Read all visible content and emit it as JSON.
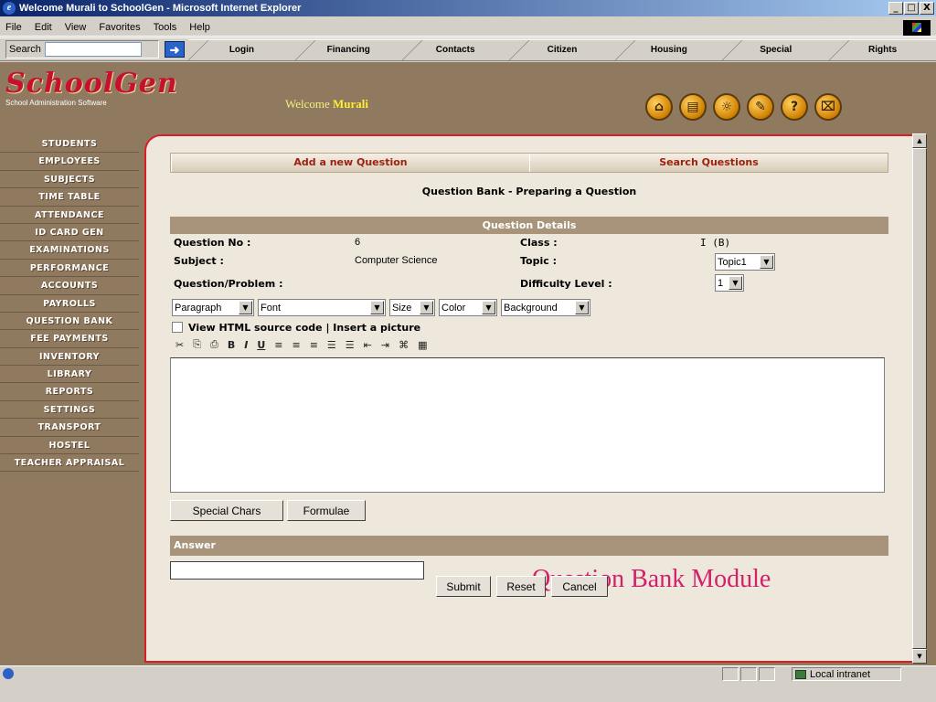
{
  "window": {
    "title": "Welcome Murali to SchoolGen - Microsoft Internet Explorer",
    "min": "_",
    "max": "□",
    "close": "X"
  },
  "menu": [
    "File",
    "Edit",
    "View",
    "Favorites",
    "Tools",
    "Help"
  ],
  "toolbar": {
    "search_label": "Search",
    "tabs": [
      "Login",
      "Financing",
      "Contacts",
      "Citizen",
      "Housing",
      "Special",
      "Rights"
    ]
  },
  "app": {
    "logo": "SchoolGen",
    "logo_sub": "School Administration Software",
    "welcome_prefix": "Welcome",
    "welcome_user": "Murali",
    "header_icons": [
      "home-icon",
      "book-icon",
      "globe-icon",
      "document-icon",
      "help-icon",
      "close-icon"
    ]
  },
  "sidebar": {
    "items": [
      "STUDENTS",
      "EMPLOYEES",
      "SUBJECTS",
      "TIME TABLE",
      "ATTENDANCE",
      "ID CARD GEN",
      "EXAMINATIONS",
      "PERFORMANCE",
      "ACCOUNTS",
      "PAYROLLS",
      "QUESTION BANK",
      "FEE PAYMENTS",
      "INVENTORY",
      "LIBRARY",
      "REPORTS",
      "SETTINGS",
      "TRANSPORT",
      "HOSTEL",
      "TEACHER APPRAISAL"
    ]
  },
  "content": {
    "tabs": [
      "Add a new Question",
      "Search Questions"
    ],
    "page_title": "Question Bank - Preparing a Question",
    "section_title": "Question Details",
    "fields": {
      "question_no_label": "Question No :",
      "question_no_value": "6",
      "class_label": "Class :",
      "class_value": "I (B)",
      "subject_label": "Subject :",
      "subject_value": "Computer Science",
      "topic_label": "Topic :",
      "topic_value": "Topic1",
      "problem_label": "Question/Problem :",
      "difficulty_label": "Difficulty Level :",
      "difficulty_value": "1"
    },
    "format": {
      "paragraph": "Paragraph",
      "font": "Font",
      "size": "Size",
      "color": "Color",
      "background": "Background"
    },
    "view_source": "View HTML source code | Insert a picture",
    "editor_icons": [
      "cut-icon",
      "copy-icon",
      "paste-icon",
      "bold-icon",
      "italic-icon",
      "underline-icon",
      "align-left-icon",
      "align-center-icon",
      "align-right-icon",
      "ordered-list-icon",
      "unordered-list-icon",
      "outdent-icon",
      "indent-icon",
      "web-link-icon",
      "table-icon"
    ],
    "editor_glyphs": [
      "✂",
      "⎘",
      "⎙",
      "B",
      "I",
      "U",
      "≡",
      "≡",
      "≡",
      "☰",
      "☰",
      "⇤",
      "⇥",
      "⌘",
      "▦"
    ],
    "special_chars": "Special Chars",
    "formulae": "Formulae",
    "answer_title": "Answer",
    "answer_value": "",
    "submit": "Submit",
    "reset": "Reset",
    "cancel": "Cancel",
    "module_label": "Question Bank Module"
  },
  "status": {
    "zone": "Local intranet"
  }
}
